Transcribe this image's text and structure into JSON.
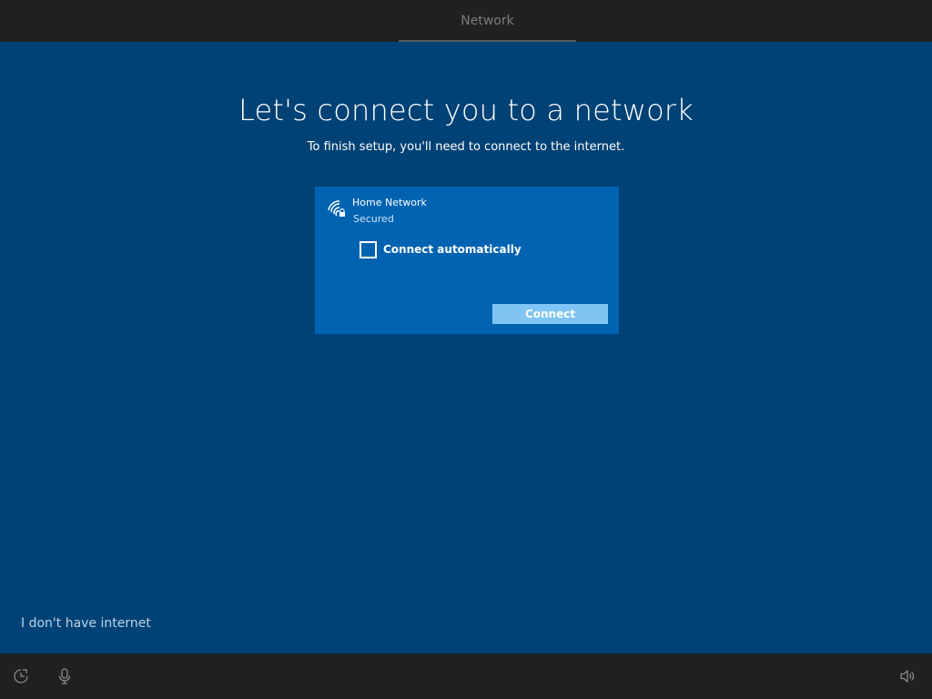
{
  "header": {
    "step_label": "Network"
  },
  "main": {
    "title": "Let's connect you to a network",
    "subtitle": "To finish setup, you'll need to connect to the internet.",
    "network": {
      "name": "Home Network",
      "status": "Secured",
      "icon": "wifi-secured-icon",
      "connect_automatically_label": "Connect automatically",
      "connect_automatically_checked": false,
      "connect_button_label": "Connect"
    },
    "no_internet_link": "I don't have internet"
  },
  "bottom_bar": {
    "icons": [
      "ease-of-access-icon",
      "microphone-icon",
      "volume-icon"
    ]
  },
  "colors": {
    "background": "#004275",
    "card": "#0063b1",
    "button": "#7fc4f2",
    "bar": "#202020"
  }
}
